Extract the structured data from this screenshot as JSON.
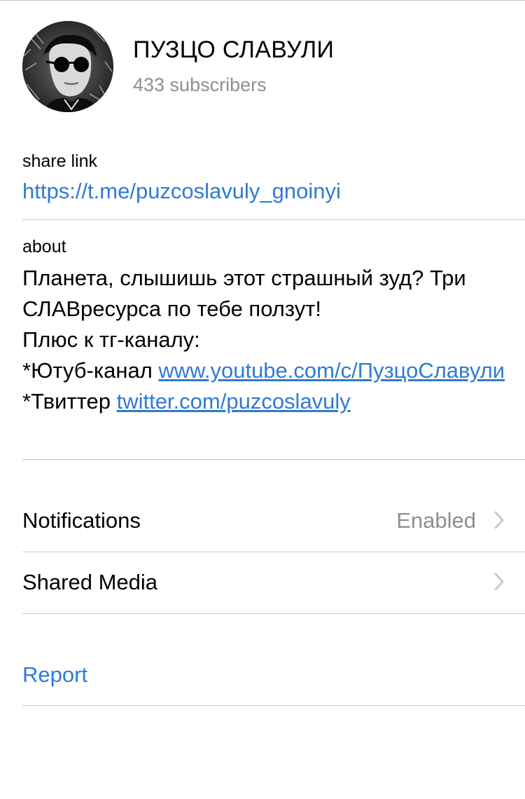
{
  "channel": {
    "title": "ПУЗЦО СЛАВУЛИ",
    "subscribers": "433 subscribers",
    "avatar_icon": "profile-photo"
  },
  "share": {
    "label": "share link",
    "url": "https://t.me/puzcoslavuly_gnoinyi"
  },
  "about": {
    "label": "about",
    "line1": "Планета, слышишь этот страшный зуд? Три СЛАВресурса по тебе ползут!",
    "line2": "Плюс к тг-каналу:",
    "youtube_prefix": "*Ютуб-канал ",
    "youtube_link": "www.youtube.com/c/ПузцоСлавули",
    "twitter_prefix": "*Твиттер ",
    "twitter_link": "twitter.com/puzcoslavuly"
  },
  "rows": {
    "notifications": {
      "label": "Notifications",
      "value": "Enabled",
      "icon": "chevron-right-icon"
    },
    "shared_media": {
      "label": "Shared Media",
      "icon": "chevron-right-icon"
    }
  },
  "report": {
    "label": "Report"
  },
  "colors": {
    "link": "#2f7ad6",
    "secondary_text": "#8e8e93",
    "separator": "#c8c7cc",
    "chevron": "#c7c7cc"
  }
}
